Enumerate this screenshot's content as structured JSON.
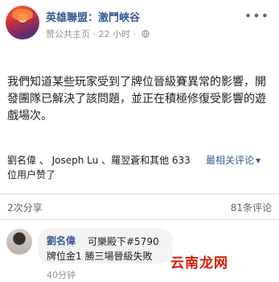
{
  "header": {
    "page_name": "英雄聯盟：激鬥峽谷",
    "host_label": "赞公共主页",
    "separator": "·",
    "time": "22 小时",
    "separator2": "·"
  },
  "post": {
    "text": "我們知道某些玩家受到了牌位晉級賽異常的影響，開發團隊已解決了該問題，並正在積極修復受影響的遊戲場次。"
  },
  "reactions": {
    "likers": "劉名偉 、 Joseph Lu 、羅翌蒼和其他 633 位用户赞了",
    "sort_label": "最相关评论"
  },
  "stats": {
    "shares": "2次分享",
    "comments": "81条评论"
  },
  "comment": {
    "author": "劉名偉",
    "text_line1": "可樂殿下#5790",
    "text_line2": "牌位金1 勝三場晉級失敗",
    "time": "40分钟"
  },
  "watermark": {
    "text": "云南龙网"
  },
  "colors": {
    "link": "#385898",
    "meta": "#90949c",
    "watermark": "#d81e06"
  }
}
